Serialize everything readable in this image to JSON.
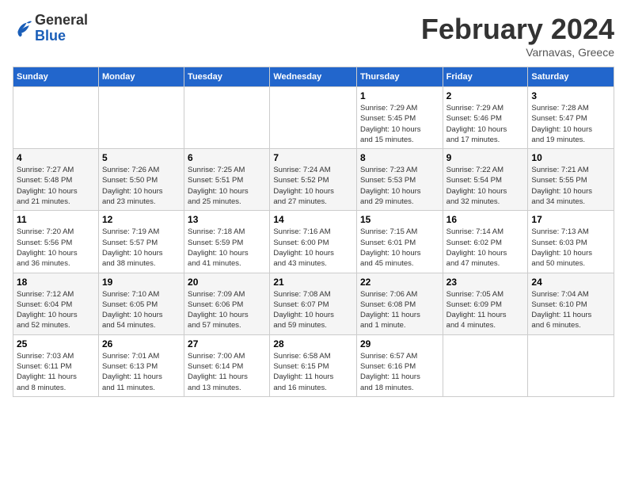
{
  "header": {
    "logo_general": "General",
    "logo_blue": "Blue",
    "month_title": "February 2024",
    "location": "Varnavas, Greece"
  },
  "days_of_week": [
    "Sunday",
    "Monday",
    "Tuesday",
    "Wednesday",
    "Thursday",
    "Friday",
    "Saturday"
  ],
  "weeks": [
    [
      {
        "day": "",
        "info": ""
      },
      {
        "day": "",
        "info": ""
      },
      {
        "day": "",
        "info": ""
      },
      {
        "day": "",
        "info": ""
      },
      {
        "day": "1",
        "info": "Sunrise: 7:29 AM\nSunset: 5:45 PM\nDaylight: 10 hours\nand 15 minutes."
      },
      {
        "day": "2",
        "info": "Sunrise: 7:29 AM\nSunset: 5:46 PM\nDaylight: 10 hours\nand 17 minutes."
      },
      {
        "day": "3",
        "info": "Sunrise: 7:28 AM\nSunset: 5:47 PM\nDaylight: 10 hours\nand 19 minutes."
      }
    ],
    [
      {
        "day": "4",
        "info": "Sunrise: 7:27 AM\nSunset: 5:48 PM\nDaylight: 10 hours\nand 21 minutes."
      },
      {
        "day": "5",
        "info": "Sunrise: 7:26 AM\nSunset: 5:50 PM\nDaylight: 10 hours\nand 23 minutes."
      },
      {
        "day": "6",
        "info": "Sunrise: 7:25 AM\nSunset: 5:51 PM\nDaylight: 10 hours\nand 25 minutes."
      },
      {
        "day": "7",
        "info": "Sunrise: 7:24 AM\nSunset: 5:52 PM\nDaylight: 10 hours\nand 27 minutes."
      },
      {
        "day": "8",
        "info": "Sunrise: 7:23 AM\nSunset: 5:53 PM\nDaylight: 10 hours\nand 29 minutes."
      },
      {
        "day": "9",
        "info": "Sunrise: 7:22 AM\nSunset: 5:54 PM\nDaylight: 10 hours\nand 32 minutes."
      },
      {
        "day": "10",
        "info": "Sunrise: 7:21 AM\nSunset: 5:55 PM\nDaylight: 10 hours\nand 34 minutes."
      }
    ],
    [
      {
        "day": "11",
        "info": "Sunrise: 7:20 AM\nSunset: 5:56 PM\nDaylight: 10 hours\nand 36 minutes."
      },
      {
        "day": "12",
        "info": "Sunrise: 7:19 AM\nSunset: 5:57 PM\nDaylight: 10 hours\nand 38 minutes."
      },
      {
        "day": "13",
        "info": "Sunrise: 7:18 AM\nSunset: 5:59 PM\nDaylight: 10 hours\nand 41 minutes."
      },
      {
        "day": "14",
        "info": "Sunrise: 7:16 AM\nSunset: 6:00 PM\nDaylight: 10 hours\nand 43 minutes."
      },
      {
        "day": "15",
        "info": "Sunrise: 7:15 AM\nSunset: 6:01 PM\nDaylight: 10 hours\nand 45 minutes."
      },
      {
        "day": "16",
        "info": "Sunrise: 7:14 AM\nSunset: 6:02 PM\nDaylight: 10 hours\nand 47 minutes."
      },
      {
        "day": "17",
        "info": "Sunrise: 7:13 AM\nSunset: 6:03 PM\nDaylight: 10 hours\nand 50 minutes."
      }
    ],
    [
      {
        "day": "18",
        "info": "Sunrise: 7:12 AM\nSunset: 6:04 PM\nDaylight: 10 hours\nand 52 minutes."
      },
      {
        "day": "19",
        "info": "Sunrise: 7:10 AM\nSunset: 6:05 PM\nDaylight: 10 hours\nand 54 minutes."
      },
      {
        "day": "20",
        "info": "Sunrise: 7:09 AM\nSunset: 6:06 PM\nDaylight: 10 hours\nand 57 minutes."
      },
      {
        "day": "21",
        "info": "Sunrise: 7:08 AM\nSunset: 6:07 PM\nDaylight: 10 hours\nand 59 minutes."
      },
      {
        "day": "22",
        "info": "Sunrise: 7:06 AM\nSunset: 6:08 PM\nDaylight: 11 hours\nand 1 minute."
      },
      {
        "day": "23",
        "info": "Sunrise: 7:05 AM\nSunset: 6:09 PM\nDaylight: 11 hours\nand 4 minutes."
      },
      {
        "day": "24",
        "info": "Sunrise: 7:04 AM\nSunset: 6:10 PM\nDaylight: 11 hours\nand 6 minutes."
      }
    ],
    [
      {
        "day": "25",
        "info": "Sunrise: 7:03 AM\nSunset: 6:11 PM\nDaylight: 11 hours\nand 8 minutes."
      },
      {
        "day": "26",
        "info": "Sunrise: 7:01 AM\nSunset: 6:13 PM\nDaylight: 11 hours\nand 11 minutes."
      },
      {
        "day": "27",
        "info": "Sunrise: 7:00 AM\nSunset: 6:14 PM\nDaylight: 11 hours\nand 13 minutes."
      },
      {
        "day": "28",
        "info": "Sunrise: 6:58 AM\nSunset: 6:15 PM\nDaylight: 11 hours\nand 16 minutes."
      },
      {
        "day": "29",
        "info": "Sunrise: 6:57 AM\nSunset: 6:16 PM\nDaylight: 11 hours\nand 18 minutes."
      },
      {
        "day": "",
        "info": ""
      },
      {
        "day": "",
        "info": ""
      }
    ]
  ]
}
